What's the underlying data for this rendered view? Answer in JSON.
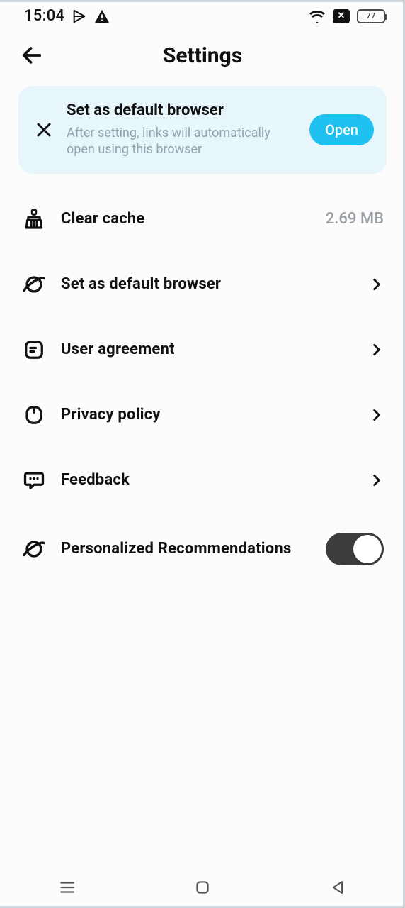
{
  "status": {
    "time": "15:04",
    "battery": "77"
  },
  "header": {
    "title": "Settings"
  },
  "banner": {
    "title": "Set as default browser",
    "subtitle": "After setting, links will automatically open using this browser",
    "button": "Open"
  },
  "items": [
    {
      "label": "Clear cache",
      "trail": "2.69 MB"
    },
    {
      "label": "Set as default browser"
    },
    {
      "label": "User agreement"
    },
    {
      "label": "Privacy policy"
    },
    {
      "label": "Feedback"
    },
    {
      "label": "Personalized Recommendations"
    }
  ]
}
